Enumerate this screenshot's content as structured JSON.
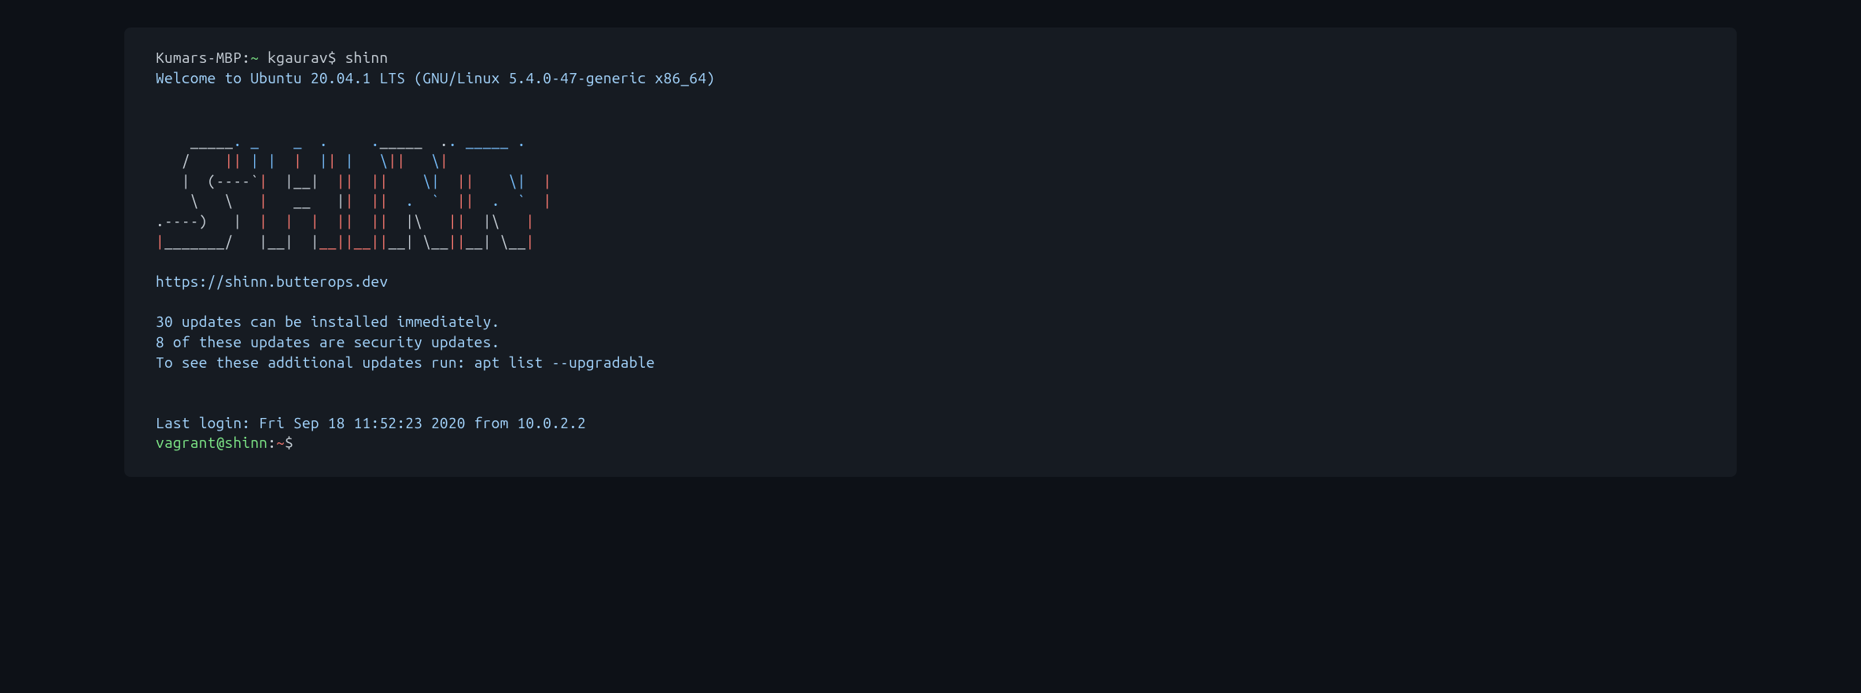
{
  "prompt": {
    "local_host": "Kumars-MBP",
    "local_sep": ":",
    "local_path": "~",
    "local_user": " kgaurav$ ",
    "command": "shinn"
  },
  "welcome": "Welcome to Ubuntu 20.04.1 LTS (GNU/Linux 5.4.0-47-generic x86_64)",
  "ascii": {
    "l1_a": "    _____",
    "l1_b": ". _    _  .     .",
    "l1_c": "_____  .",
    "l1_d": ". _____ .",
    "l2_a": "   /    ",
    "l2_b": "|",
    "l2_c": "|",
    "l2_d": " |",
    "l2_e": " |  ",
    "l2_f": "|",
    "l2_g": "  |",
    "l2_h": "|",
    "l2_i": " |",
    "l2_j": "   \\",
    "l2_k": "|",
    "l2_l": "|",
    "l2_m": "   \\",
    "l2_n": "|",
    "l3_a": "   |  (----`",
    "l3_b": "|",
    "l3_c": "  |__|",
    "l3_d": "  |",
    "l3_e": "|",
    "l3_f": "  |",
    "l3_g": "|",
    "l3_h": "    \\|",
    "l3_i": "  |",
    "l3_j": "|",
    "l3_k": "    \\|",
    "l3_l": "  |",
    "l4_a": "    \\   \\",
    "l4_b": "   |",
    "l4_c": "   __   |",
    "l4_d": "|",
    "l4_e": "  |",
    "l4_f": "|",
    "l4_g": "  .  `",
    "l4_h": "  |",
    "l4_i": "|",
    "l4_j": "  .  `",
    "l4_k": "  |",
    "l5_a": ".----)   |",
    "l5_b": "  |",
    "l5_c": "  |  |",
    "l5_d": "  |",
    "l5_e": "|",
    "l5_f": "  |",
    "l5_g": "|",
    "l5_h": "  |\\   ",
    "l5_i": "|",
    "l5_j": "|",
    "l5_k": "  |\\   ",
    "l5_l": "|",
    "l6_a": "|",
    "l6_b": "_______/   |",
    "l6_c": "__|  |",
    "l6_d": "__|",
    "l6_e": "|",
    "l6_f": "__|",
    "l6_g": "|",
    "l6_h": "__| \\__",
    "l6_i": "|",
    "l6_j": "|",
    "l6_k": "__| \\__",
    "l6_l": "|"
  },
  "url": "https://shinn.butterops.dev",
  "updates": {
    "line1": "30 updates can be installed immediately.",
    "line2": "8 of these updates are security updates.",
    "line3": "To see these additional updates run: apt list --upgradable"
  },
  "last_login": "Last login: Fri Sep 18 11:52:23 2020 from 10.0.2.2",
  "vagrant_prompt": {
    "userhost": "vagrant@shinn",
    "sep": ":",
    "tilde": "~",
    "dollar": "$"
  }
}
